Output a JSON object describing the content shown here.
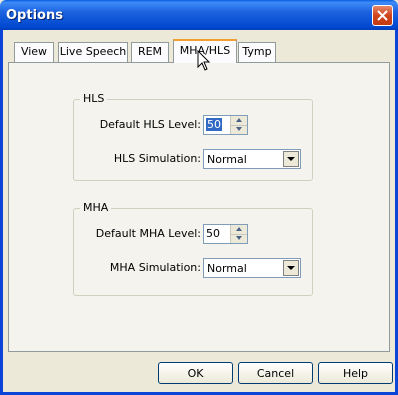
{
  "window": {
    "title": "Options"
  },
  "tabs": [
    {
      "label": "View"
    },
    {
      "label": "Live Speech"
    },
    {
      "label": "REM"
    },
    {
      "label": "MHA/HLS"
    },
    {
      "label": "Tymp"
    }
  ],
  "active_tab": "MHA/HLS",
  "hls_group": {
    "legend": "HLS",
    "level_label": "Default HLS Level:",
    "level_value": "50",
    "simulation_label": "HLS Simulation:",
    "simulation_value": "Normal"
  },
  "mha_group": {
    "legend": "MHA",
    "level_label": "Default MHA Level:",
    "level_value": "50",
    "simulation_label": "MHA Simulation:",
    "simulation_value": "Normal"
  },
  "buttons": {
    "ok": "OK",
    "cancel": "Cancel",
    "help": "Help"
  },
  "icons": {
    "close": "close-icon",
    "spin_up": "spin-up-icon",
    "spin_down": "spin-down-icon",
    "dropdown": "dropdown-arrow-icon",
    "cursor": "mouse-cursor-icon"
  },
  "colors": {
    "titlebar": "#0a5fe0",
    "dialog_bg": "#ece9d8",
    "close_button": "#d0461e",
    "tab_highlight": "#f3a02f",
    "selection": "#316ac5"
  }
}
